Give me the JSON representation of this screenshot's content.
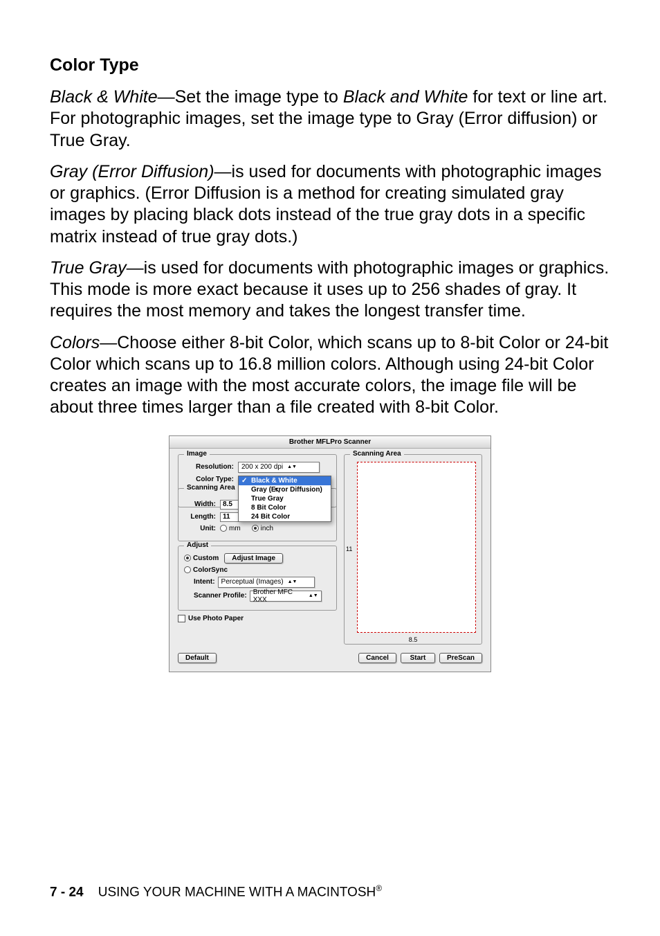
{
  "heading": "Color Type",
  "para1_term": "Black & White",
  "para1_rest": "—Set the image type to ",
  "para1_term2": "Black and White",
  "para1_rest2": " for text or line art. For photographic images, set the image type to Gray (Error diffusion) or True Gray.",
  "para2_term": "Gray (Error Diffusion)",
  "para2_rest": "—is used for documents with photographic images or graphics. (Error Diffusion is a method for creating simulated gray images by placing black dots instead of the true gray dots in a specific matrix instead of true gray dots.)",
  "para3_term": "True Gray",
  "para3_rest": "—is used for documents with photographic images or graphics. This mode is more exact because it uses up to 256 shades of gray. It requires the most memory and takes the longest transfer time.",
  "para4_term": "Colors",
  "para4_rest": "—Choose either 8-bit Color, which scans up to 8-bit Color or 24-bit Color which scans up to 16.8 million colors. Although using 24-bit Color creates an image with the most accurate colors, the image file will be about three times larger than a file created with 8-bit Color.",
  "dialog": {
    "title": "Brother MFLPro Scanner",
    "image_legend": "Image",
    "resolution_label": "Resolution:",
    "resolution_value": "200 x 200 dpi",
    "colortype_label": "Color Type:",
    "dropdown": {
      "opt1": "Black & White",
      "opt2": "Gray (Error Diffusion)",
      "opt3": "True Gray",
      "opt4": "8 Bit Color",
      "opt5": "24 Bit Color"
    },
    "scanarea_legend": "Scanning Area",
    "width_label": "Width:",
    "width_value": "8.5",
    "length_label": "Length:",
    "length_value": "11",
    "unit_label": "Unit:",
    "unit_mm": "mm",
    "unit_inch": "inch",
    "adjust_legend": "Adjust",
    "custom_label": "Custom",
    "adjust_image_btn": "Adjust Image",
    "colorsync_label": "ColorSync",
    "intent_label": "Intent:",
    "intent_value": "Perceptual (Images)",
    "profile_label": "Scanner Profile:",
    "profile_value": "Brother MFC XXX",
    "photo_paper": "Use Photo Paper",
    "default_btn": "Default",
    "scanning_area_legend": "Scanning Area",
    "preview_h": "8.5",
    "preview_v": "11",
    "cancel_btn": "Cancel",
    "start_btn": "Start",
    "prescan_btn": "PreScan"
  },
  "footer_page": "7 - 24",
  "footer_text": "USING YOUR MACHINE WITH A MACINTOSH",
  "footer_reg": "®"
}
